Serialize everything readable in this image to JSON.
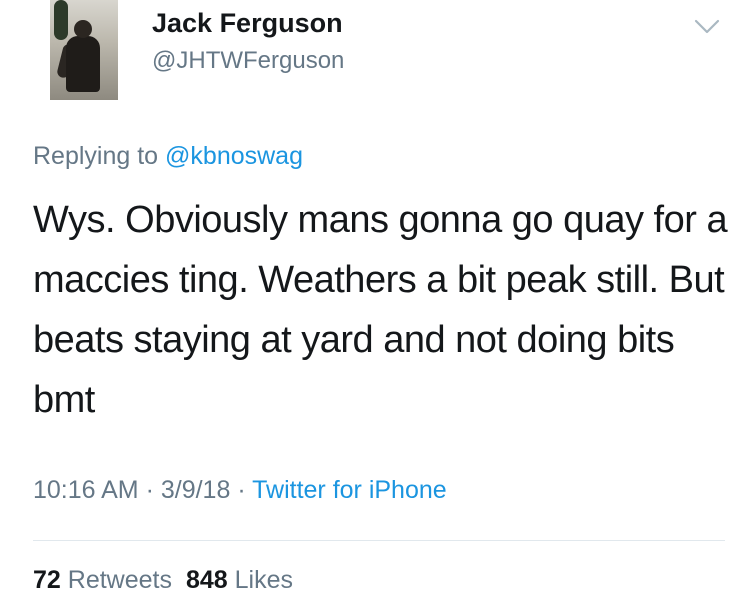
{
  "user": {
    "display_name": "Jack Ferguson",
    "handle": "@JHTWFerguson"
  },
  "reply": {
    "prefix": "Replying to ",
    "mention": "@kbnoswag"
  },
  "tweet": {
    "text": "Wys. Obviously mans gonna go quay for a maccies ting. Weathers a bit peak still. But beats staying at yard and not doing bits bmt"
  },
  "meta": {
    "time": "10:16 AM",
    "sep1": " · ",
    "date": "3/9/18",
    "sep2": " · ",
    "source": "Twitter for iPhone"
  },
  "stats": {
    "retweets_count": "72",
    "retweets_label": "Retweets",
    "likes_count": "848",
    "likes_label": "Likes"
  },
  "colors": {
    "link": "#1b95e0",
    "secondary": "#657786",
    "primary": "#14171a",
    "divider": "#e1e8ed"
  },
  "icons": {
    "menu": "chevron-down-icon"
  }
}
